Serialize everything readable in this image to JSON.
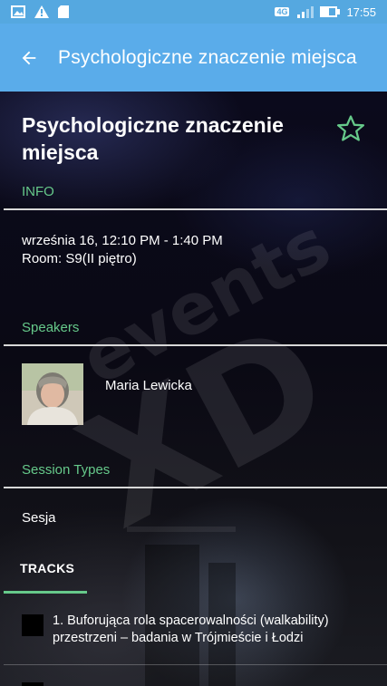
{
  "status_bar": {
    "network": "4G",
    "time": "17:55",
    "icons": [
      "image-icon",
      "warning-icon",
      "sd-card-icon",
      "signal-icon",
      "battery-icon"
    ]
  },
  "app_bar": {
    "title": "Psychologiczne znaczenie miejsca",
    "back_icon": "arrow-back-icon",
    "color": "#5aacea"
  },
  "event": {
    "title": "Psychologiczne znaczenie miejsca",
    "favorite_icon": "star-outline-icon",
    "accent_color": "#66c98a"
  },
  "info": {
    "label": "INFO",
    "time": "września 16, 12:10 PM - 1:40 PM",
    "room": "Room: S9(II piętro)"
  },
  "speakers": {
    "label": "Speakers",
    "items": [
      {
        "name": "Maria Lewicka"
      }
    ]
  },
  "session_types": {
    "label": "Session Types",
    "value": "Sesja"
  },
  "tracks": {
    "tab_label": "TRACKS",
    "items": [
      {
        "label": "1. Buforująca rola spacerowalności (walkability) przestrzeni – badania w Trójmieście i Łodzi",
        "color": "#000000"
      }
    ]
  },
  "background": {
    "watermark_text_1": "events",
    "watermark_text_2": "XD"
  }
}
